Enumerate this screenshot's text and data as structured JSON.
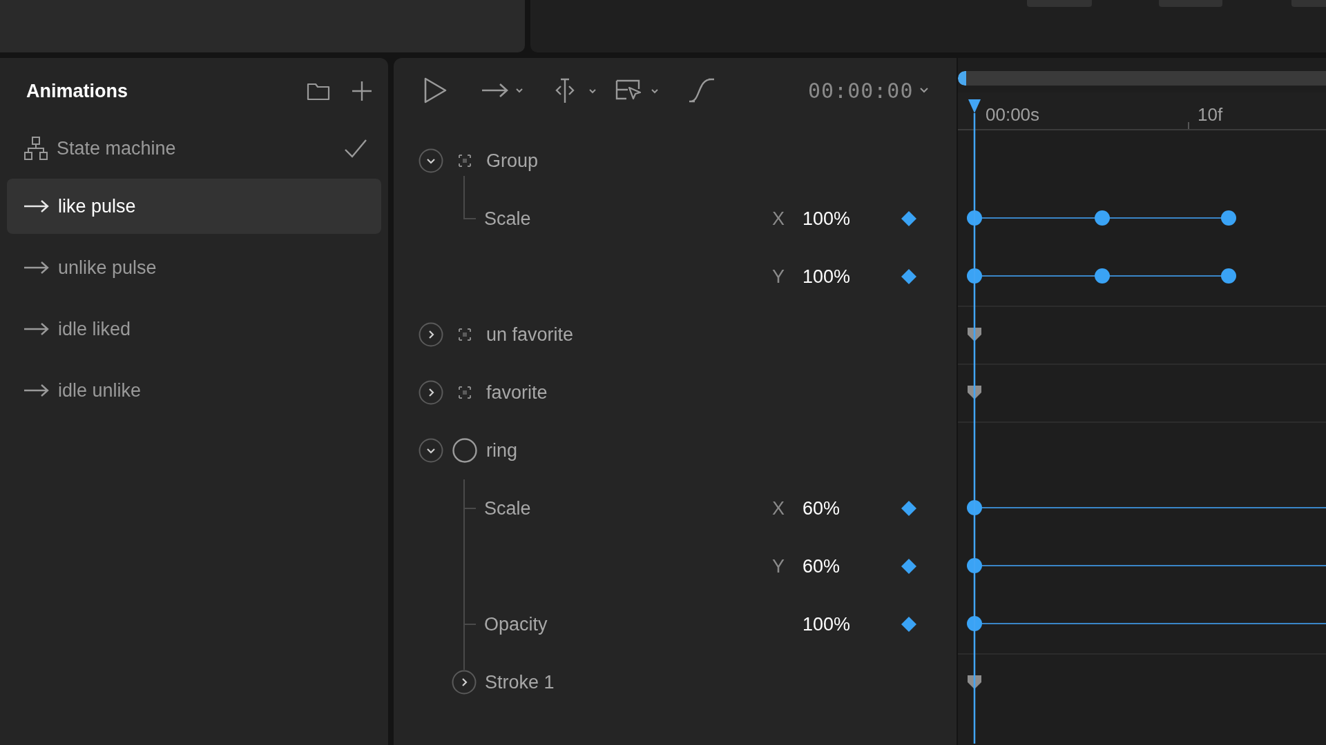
{
  "animations_panel": {
    "title": "Animations",
    "items": [
      {
        "kind": "state_machine",
        "label": "State machine",
        "selected": false
      },
      {
        "kind": "animation",
        "label": "like pulse",
        "selected": true
      },
      {
        "kind": "animation",
        "label": "unlike pulse",
        "selected": false
      },
      {
        "kind": "animation",
        "label": "idle liked",
        "selected": false
      },
      {
        "kind": "animation",
        "label": "idle unlike",
        "selected": false
      }
    ]
  },
  "toolbar": {
    "timecode": "00:00:00"
  },
  "timeline": {
    "ruler": [
      "00:00s",
      "10f"
    ]
  },
  "layers": [
    {
      "kind": "group",
      "name": "Group",
      "expanded": true,
      "children": [
        {
          "kind": "property",
          "name": "Scale",
          "channels": [
            {
              "axis": "X",
              "value": "100%",
              "kind": "animated"
            },
            {
              "axis": "Y",
              "value": "100%",
              "kind": "animated"
            }
          ]
        }
      ]
    },
    {
      "kind": "group",
      "name": "un favorite",
      "expanded": false
    },
    {
      "kind": "group",
      "name": "favorite",
      "expanded": false
    },
    {
      "kind": "ellipse",
      "name": "ring",
      "expanded": true,
      "children": [
        {
          "kind": "property",
          "name": "Scale",
          "channels": [
            {
              "axis": "X",
              "value": "60%",
              "kind": "held"
            },
            {
              "axis": "Y",
              "value": "60%",
              "kind": "held"
            }
          ]
        },
        {
          "kind": "property",
          "name": "Opacity",
          "channels": [
            {
              "value": "100%",
              "kind": "held"
            }
          ]
        },
        {
          "kind": "stroke",
          "name": "Stroke 1",
          "expanded": false
        }
      ]
    }
  ]
}
